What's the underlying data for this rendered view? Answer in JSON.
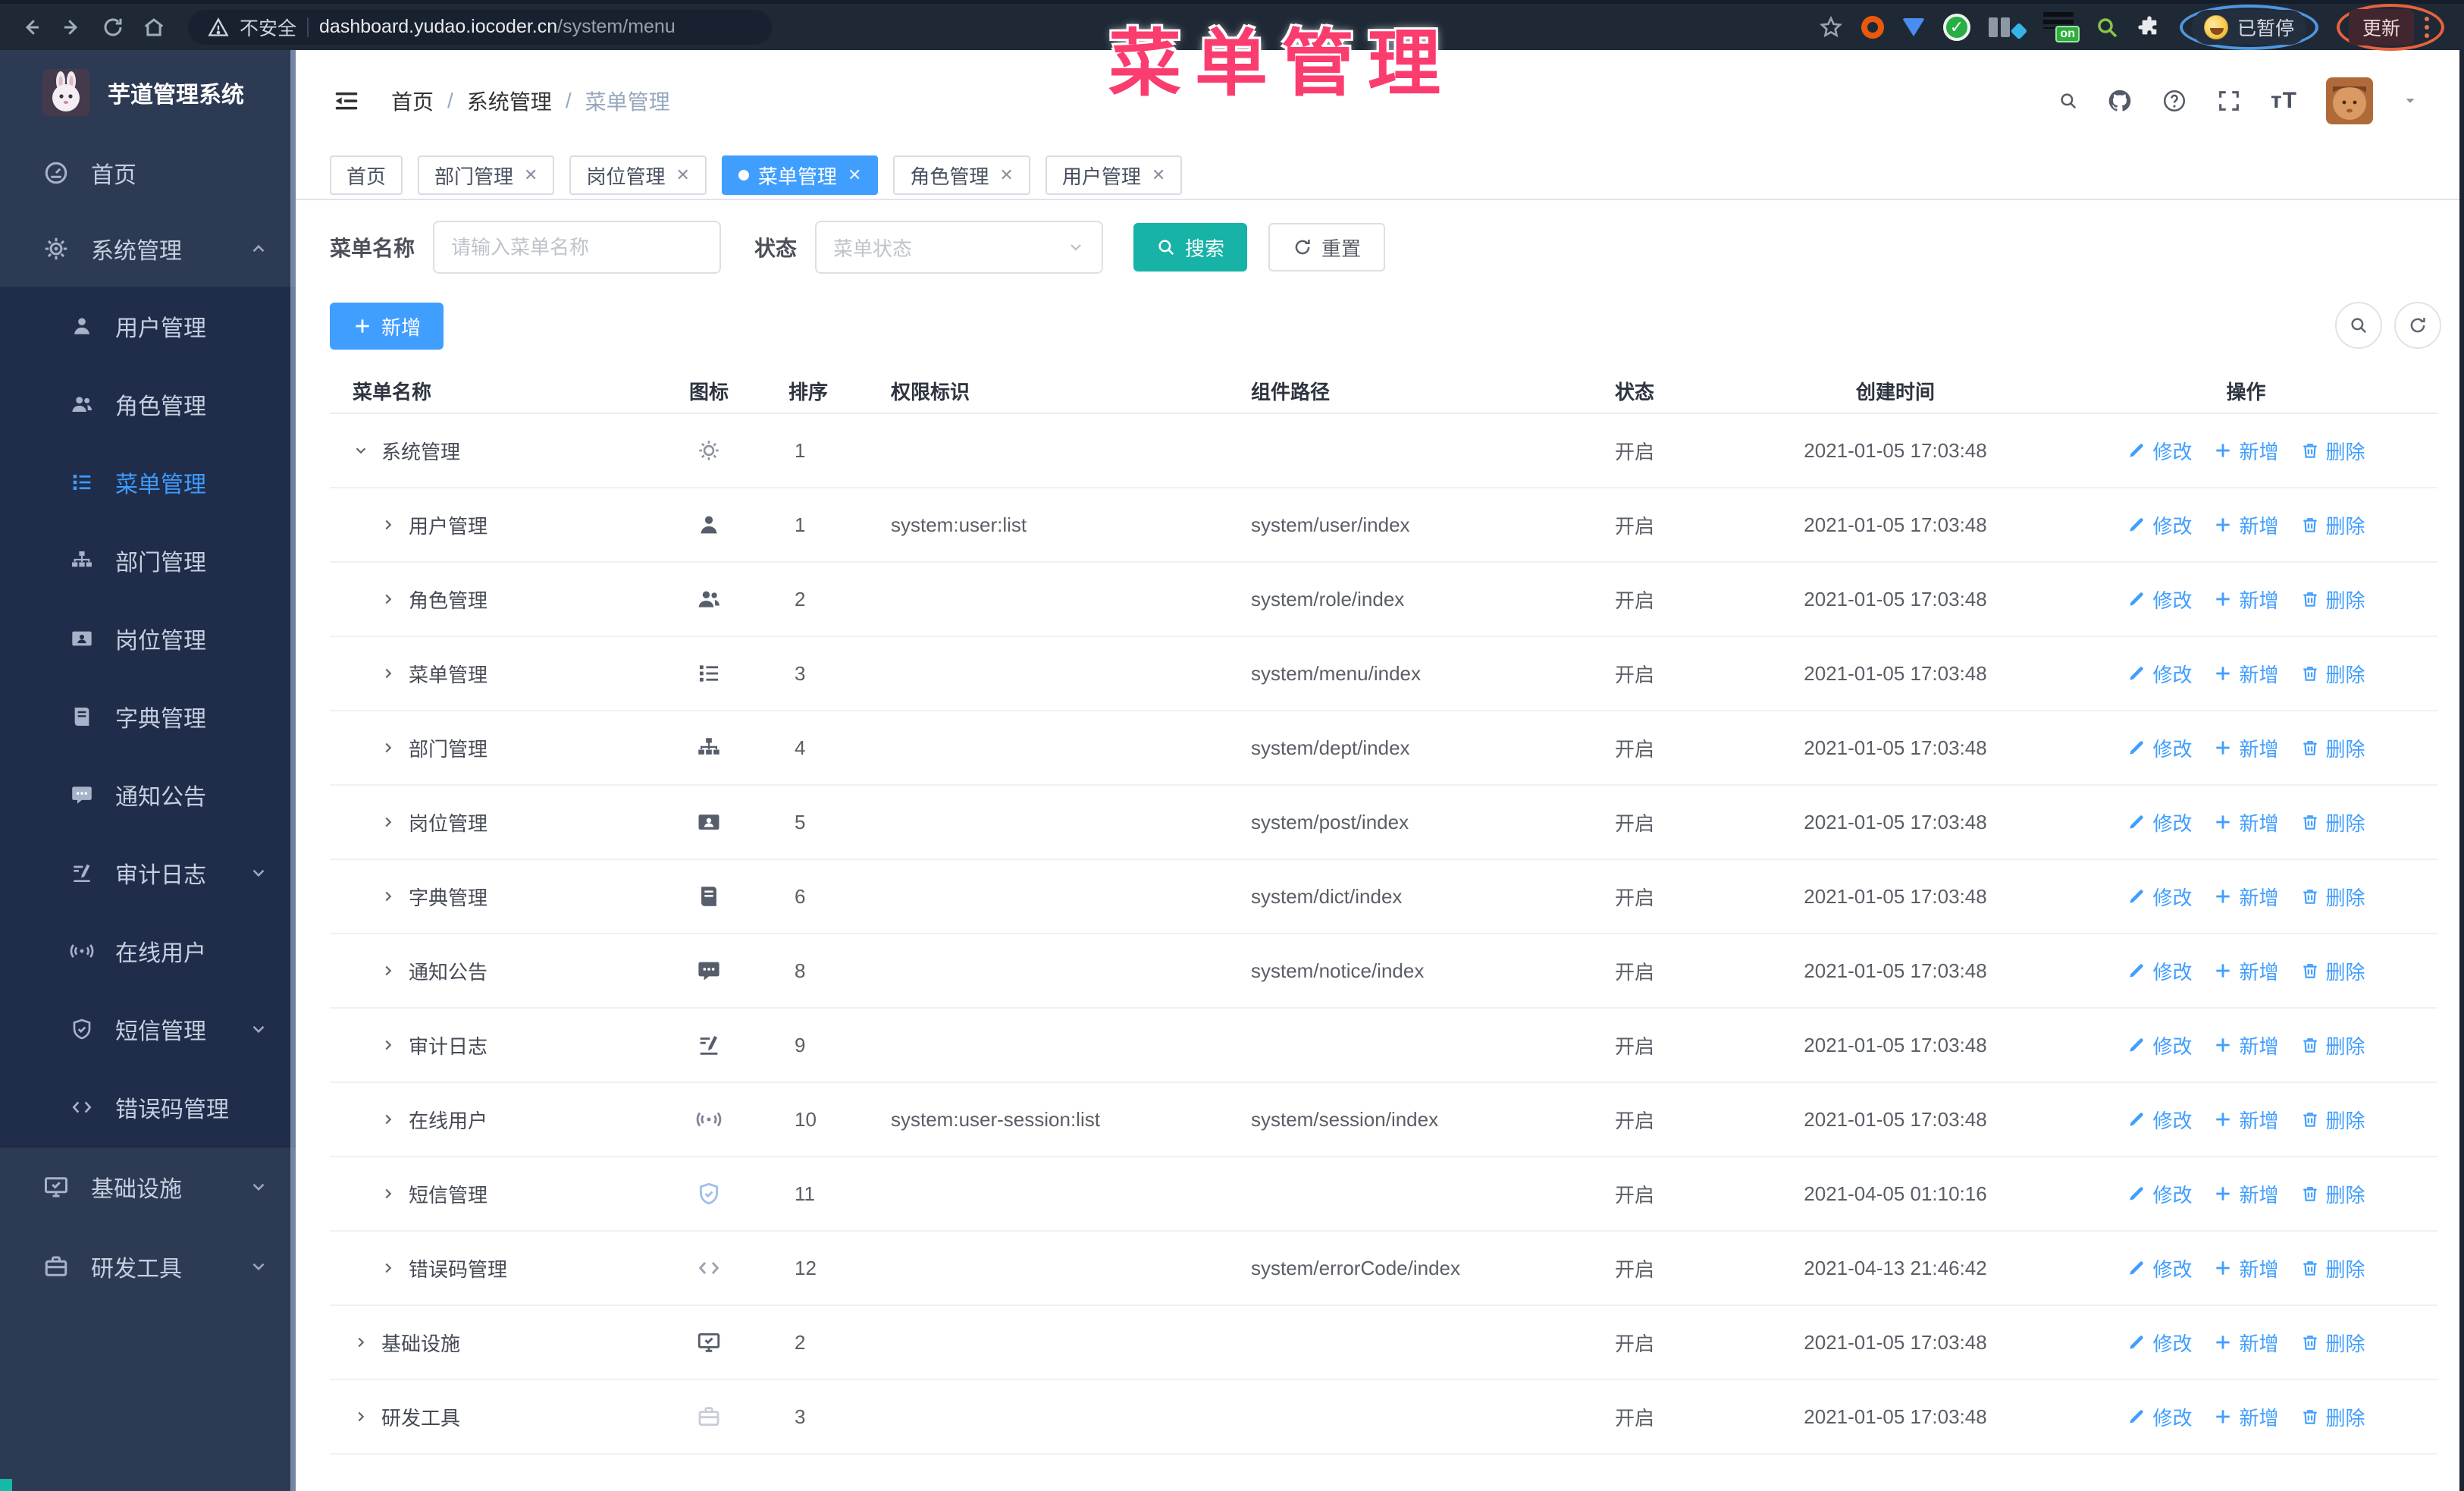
{
  "browser": {
    "security_label": "不安全",
    "url_domain": "dashboard.yudao.iocoder.cn",
    "url_path": "/system/menu",
    "paused_badge": "已暂停",
    "update_button": "更新",
    "on_badge": "on"
  },
  "annotation": {
    "title": "菜单管理"
  },
  "colors": {
    "accent_blue": "#409eff",
    "accent_teal": "#17b3a6",
    "annotation_pink": "#fb3c6e",
    "sidebar_bg": "#2d3a54",
    "submenu_bg": "#202d4a"
  },
  "sidebar": {
    "logo_title": "芋道管理系统",
    "items": [
      {
        "label": "首页",
        "icon": "dashboard",
        "type": "root"
      },
      {
        "label": "系统管理",
        "icon": "gear",
        "type": "root",
        "chevron": "up"
      },
      {
        "label": "用户管理",
        "icon": "user",
        "type": "sub"
      },
      {
        "label": "角色管理",
        "icon": "users",
        "type": "sub"
      },
      {
        "label": "菜单管理",
        "icon": "menu",
        "type": "sub",
        "active": true
      },
      {
        "label": "部门管理",
        "icon": "tree",
        "type": "sub"
      },
      {
        "label": "岗位管理",
        "icon": "badge",
        "type": "sub"
      },
      {
        "label": "字典管理",
        "icon": "book",
        "type": "sub"
      },
      {
        "label": "通知公告",
        "icon": "notice",
        "type": "sub"
      },
      {
        "label": "审计日志",
        "icon": "edit",
        "type": "sub",
        "chevron": "down"
      },
      {
        "label": "在线用户",
        "icon": "online",
        "type": "sub"
      },
      {
        "label": "短信管理",
        "icon": "shield",
        "type": "sub",
        "chevron": "down"
      },
      {
        "label": "错误码管理",
        "icon": "code",
        "type": "sub"
      },
      {
        "label": "基础设施",
        "icon": "monitor",
        "type": "root",
        "chevron": "down"
      },
      {
        "label": "研发工具",
        "icon": "briefcase",
        "type": "root",
        "chevron": "down"
      }
    ]
  },
  "header": {
    "breadcrumb": [
      "首页",
      "系统管理",
      "菜单管理"
    ]
  },
  "tabs": [
    {
      "label": "首页"
    },
    {
      "label": "部门管理",
      "closable": true
    },
    {
      "label": "岗位管理",
      "closable": true
    },
    {
      "label": "菜单管理",
      "closable": true,
      "active": true
    },
    {
      "label": "角色管理",
      "closable": true
    },
    {
      "label": "用户管理",
      "closable": true
    }
  ],
  "filters": {
    "name_label": "菜单名称",
    "name_placeholder": "请输入菜单名称",
    "status_label": "状态",
    "status_placeholder": "菜单状态",
    "search_label": "搜索",
    "reset_label": "重置"
  },
  "toolbar": {
    "add_label": "新增"
  },
  "table": {
    "columns": [
      "菜单名称",
      "图标",
      "排序",
      "权限标识",
      "组件路径",
      "状态",
      "创建时间",
      "操作"
    ],
    "actions": {
      "edit": "修改",
      "add": "新增",
      "delete": "删除"
    },
    "rows": [
      {
        "name": "系统管理",
        "level": 0,
        "expand": "down",
        "icon": "gear-outline",
        "sort": "1",
        "perm": "",
        "path": "",
        "status": "开启",
        "time": "2021-01-05 17:03:48"
      },
      {
        "name": "用户管理",
        "level": 1,
        "expand": "right",
        "icon": "user",
        "sort": "1",
        "perm": "system:user:list",
        "path": "system/user/index",
        "status": "开启",
        "time": "2021-01-05 17:03:48"
      },
      {
        "name": "角色管理",
        "level": 1,
        "expand": "right",
        "icon": "users",
        "sort": "2",
        "perm": "",
        "path": "system/role/index",
        "status": "开启",
        "time": "2021-01-05 17:03:48"
      },
      {
        "name": "菜单管理",
        "level": 1,
        "expand": "right",
        "icon": "menu",
        "sort": "3",
        "perm": "",
        "path": "system/menu/index",
        "status": "开启",
        "time": "2021-01-05 17:03:48"
      },
      {
        "name": "部门管理",
        "level": 1,
        "expand": "right",
        "icon": "tree",
        "sort": "4",
        "perm": "",
        "path": "system/dept/index",
        "status": "开启",
        "time": "2021-01-05 17:03:48"
      },
      {
        "name": "岗位管理",
        "level": 1,
        "expand": "right",
        "icon": "badge",
        "sort": "5",
        "perm": "",
        "path": "system/post/index",
        "status": "开启",
        "time": "2021-01-05 17:03:48"
      },
      {
        "name": "字典管理",
        "level": 1,
        "expand": "right",
        "icon": "book",
        "sort": "6",
        "perm": "",
        "path": "system/dict/index",
        "status": "开启",
        "time": "2021-01-05 17:03:48"
      },
      {
        "name": "通知公告",
        "level": 1,
        "expand": "right",
        "icon": "notice",
        "sort": "8",
        "perm": "",
        "path": "system/notice/index",
        "status": "开启",
        "time": "2021-01-05 17:03:48"
      },
      {
        "name": "审计日志",
        "level": 1,
        "expand": "right",
        "icon": "edit",
        "sort": "9",
        "perm": "",
        "path": "",
        "status": "开启",
        "time": "2021-01-05 17:03:48"
      },
      {
        "name": "在线用户",
        "level": 1,
        "expand": "right",
        "icon": "online",
        "sort": "10",
        "perm": "system:user-session:list",
        "path": "system/session/index",
        "status": "开启",
        "time": "2021-01-05 17:03:48"
      },
      {
        "name": "短信管理",
        "level": 1,
        "expand": "right",
        "icon": "shield",
        "sort": "11",
        "perm": "",
        "path": "",
        "status": "开启",
        "time": "2021-04-05 01:10:16"
      },
      {
        "name": "错误码管理",
        "level": 1,
        "expand": "right",
        "icon": "code",
        "sort": "12",
        "perm": "",
        "path": "system/errorCode/index",
        "status": "开启",
        "time": "2021-04-13 21:46:42"
      },
      {
        "name": "基础设施",
        "level": 0,
        "expand": "right",
        "icon": "monitor",
        "sort": "2",
        "perm": "",
        "path": "",
        "status": "开启",
        "time": "2021-01-05 17:03:48"
      },
      {
        "name": "研发工具",
        "level": 0,
        "expand": "right",
        "icon": "briefcase-light",
        "sort": "3",
        "perm": "",
        "path": "",
        "status": "开启",
        "time": "2021-01-05 17:03:48"
      }
    ]
  }
}
